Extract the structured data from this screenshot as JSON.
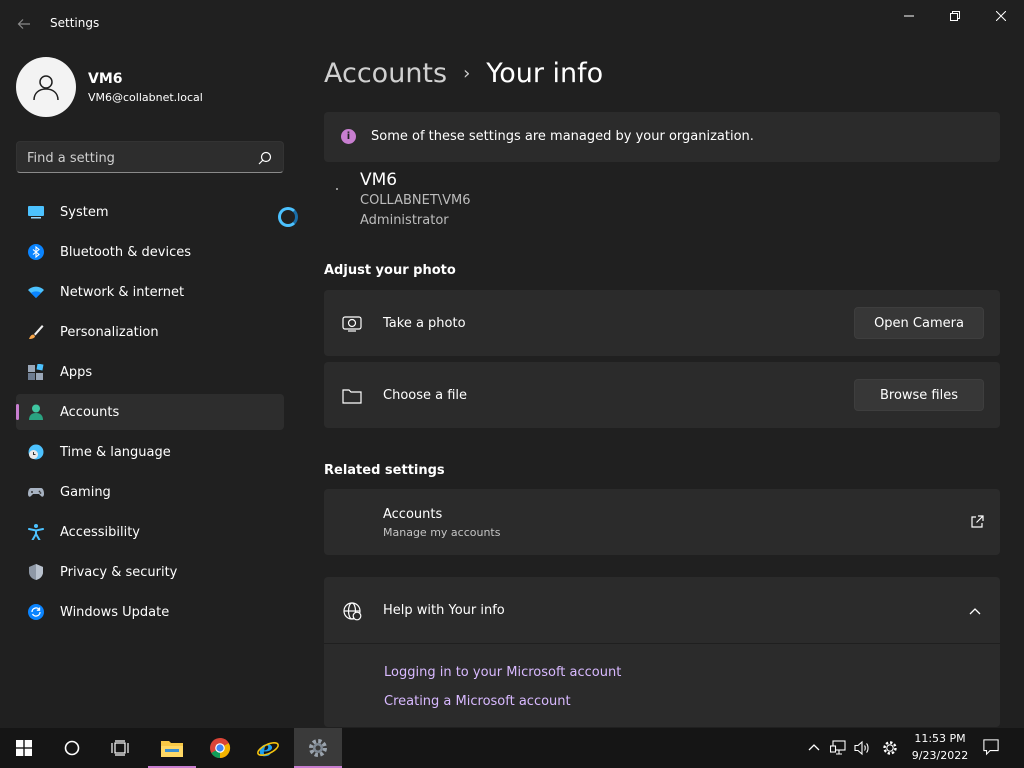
{
  "window": {
    "title": "Settings"
  },
  "profile": {
    "name": "VM6",
    "email": "VM6@collabnet.local"
  },
  "search": {
    "placeholder": "Find a setting"
  },
  "sidebar": {
    "items": [
      {
        "label": "System",
        "icon": "monitor-icon"
      },
      {
        "label": "Bluetooth & devices",
        "icon": "bluetooth-icon"
      },
      {
        "label": "Network & internet",
        "icon": "wifi-icon"
      },
      {
        "label": "Personalization",
        "icon": "paintbrush-icon"
      },
      {
        "label": "Apps",
        "icon": "apps-grid-icon"
      },
      {
        "label": "Accounts",
        "icon": "person-icon",
        "active": true
      },
      {
        "label": "Time & language",
        "icon": "globe-clock-icon"
      },
      {
        "label": "Gaming",
        "icon": "gamepad-icon"
      },
      {
        "label": "Accessibility",
        "icon": "accessibility-icon"
      },
      {
        "label": "Privacy & security",
        "icon": "shield-icon"
      },
      {
        "label": "Windows Update",
        "icon": "sync-icon"
      }
    ]
  },
  "breadcrumb": {
    "parent": "Accounts",
    "separator": "›",
    "current": "Your info"
  },
  "org_banner": {
    "text": "Some of these settings are managed by your organization.",
    "info_glyph": "i"
  },
  "user": {
    "name": "VM6",
    "domain": "COLLABNET\\VM6",
    "role": "Administrator"
  },
  "adjust_photo": {
    "heading": "Adjust your photo",
    "take_photo": {
      "label": "Take a photo",
      "button": "Open Camera"
    },
    "choose_file": {
      "label": "Choose a file",
      "button": "Browse files"
    }
  },
  "related": {
    "heading": "Related settings",
    "accounts_title": "Accounts",
    "accounts_subtitle": "Manage my accounts"
  },
  "help": {
    "title": "Help with Your info",
    "links": [
      "Logging in to your Microsoft account",
      "Creating a Microsoft account"
    ]
  },
  "taskbar": {
    "time": "11:53 PM",
    "date": "9/23/2022"
  },
  "colors": {
    "background": "#202020",
    "card": "#2b2b2b",
    "accent": "#c87ed0",
    "link": "#d8b9ff",
    "taskbar": "#151515"
  }
}
